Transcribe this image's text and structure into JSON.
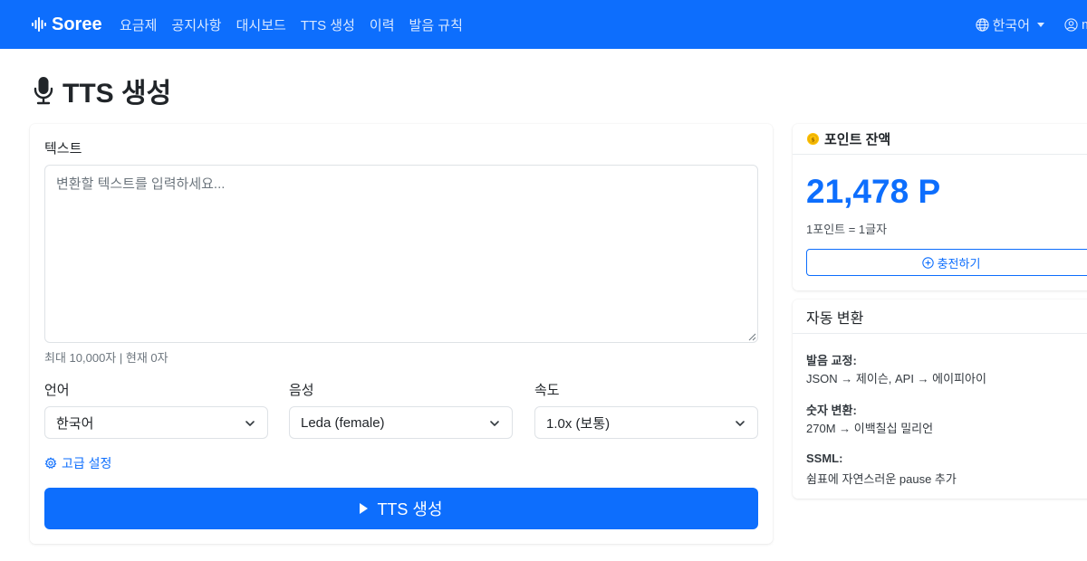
{
  "navbar": {
    "brand": "Soree",
    "links": [
      "요금제",
      "공지사항",
      "대시보드",
      "TTS 생성",
      "이력",
      "발음 규칙"
    ],
    "language": "한국어",
    "user_initial": "m",
    "colors": {
      "primary": "#0d6efd"
    }
  },
  "page": {
    "title": "TTS 생성",
    "title_icon": "microphone-icon"
  },
  "form": {
    "text_label": "텍스트",
    "text_placeholder": "변환할 텍스트를 입력하세요...",
    "text_value": "",
    "char_count": "최대 10,000자 | 현재 0자",
    "language_label": "언어",
    "language_value": "한국어",
    "voice_label": "음성",
    "voice_value": "Leda (female)",
    "speed_label": "속도",
    "speed_value": "1.0x (보통)",
    "advanced_label": "고급 설정",
    "submit_label": "TTS 생성"
  },
  "points": {
    "header": "포인트 잔액",
    "value": "21,478 P",
    "rate": "1포인트 = 1글자",
    "charge_label": "충전하기"
  },
  "auto_convert": {
    "header": "자동 변환",
    "rules": [
      {
        "title": "발음 교정:",
        "body": "JSON → 제이슨, API → 에이피아이"
      },
      {
        "title": "숫자 변환:",
        "body": "270M → 이백칠십 밀리언"
      },
      {
        "title": "SSML:",
        "body": "쉼표에 자연스러운 pause 추가"
      }
    ]
  }
}
